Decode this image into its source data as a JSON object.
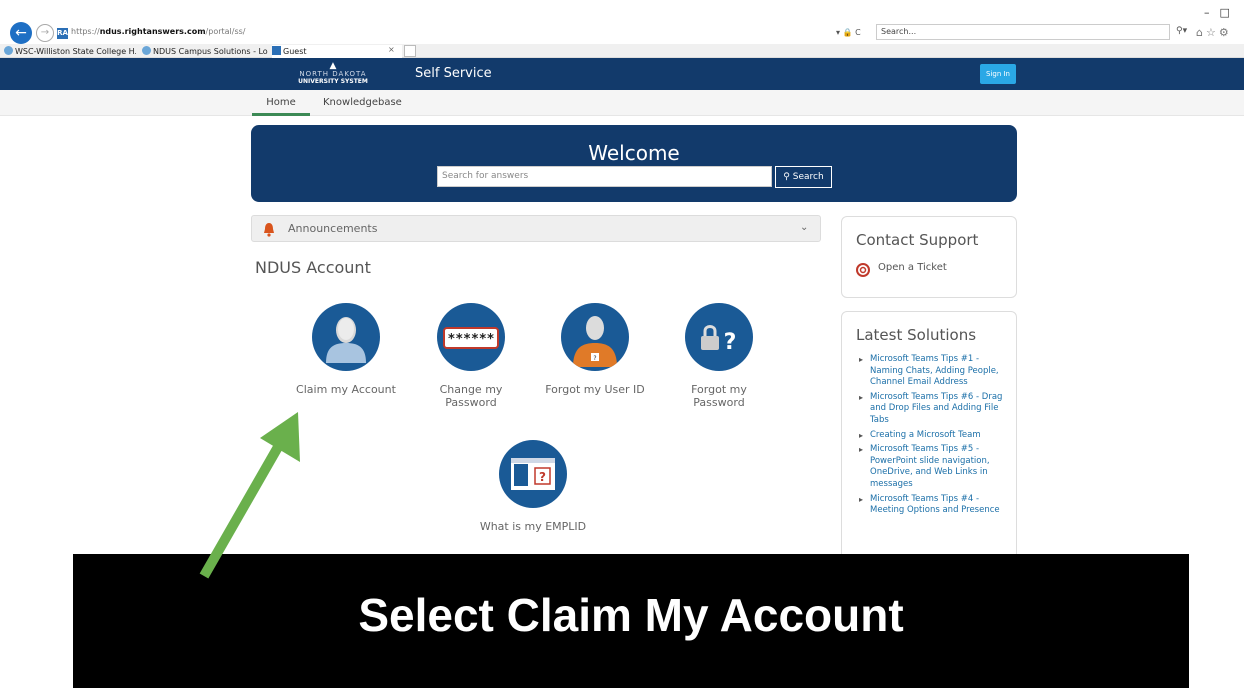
{
  "browser": {
    "url_prefix": "https://",
    "url_domain_sub": "ndus.",
    "url_domain": "rightanswers.com",
    "url_path": "/portal/ss/",
    "addr_right": "▾ 🔒 C",
    "search_placeholder": "Search...",
    "tabs": [
      {
        "label": "WSC-Williston State College H..."
      },
      {
        "label": "NDUS Campus Solutions - Log..."
      },
      {
        "label": "Guest"
      }
    ]
  },
  "header": {
    "logo_line1": "NORTH DAKOTA",
    "logo_line2": "UNIVERSITY SYSTEM",
    "title": "Self Service",
    "signin": "Sign In"
  },
  "subnav": {
    "home": "Home",
    "knowledgebase": "Knowledgebase"
  },
  "welcome": {
    "title": "Welcome",
    "search_placeholder": "Search for answers",
    "search_button": "Search"
  },
  "announcements": {
    "label": "Announcements"
  },
  "account": {
    "title": "NDUS Account",
    "tiles": [
      {
        "label": "Claim my Account"
      },
      {
        "label": "Change my Password"
      },
      {
        "label": "Forgot my User ID"
      },
      {
        "label": "Forgot my Password"
      },
      {
        "label": "What is my EMPLID"
      }
    ],
    "password_mask": "******"
  },
  "contact": {
    "title": "Contact Support",
    "link": "Open a Ticket"
  },
  "latest": {
    "title": "Latest Solutions",
    "items": [
      "Microsoft Teams Tips #1 - Naming Chats, Adding People, Channel Email Address",
      "Microsoft Teams Tips #6 - Drag and Drop Files and Adding File Tabs",
      "Creating a Microsoft Team",
      "Microsoft Teams Tips #5 - PowerPoint slide navigation, OneDrive, and Web Links in messages",
      "Microsoft Teams Tips #4 - Meeting Options and Presence"
    ]
  },
  "banner": {
    "text": "Select Claim My Account"
  },
  "colors": {
    "navy": "#123a6b",
    "tile_blue": "#1a5a96",
    "signin_blue": "#2aa8e6",
    "arrow_green": "#6ab04c",
    "link_blue": "#1b6fa8"
  }
}
